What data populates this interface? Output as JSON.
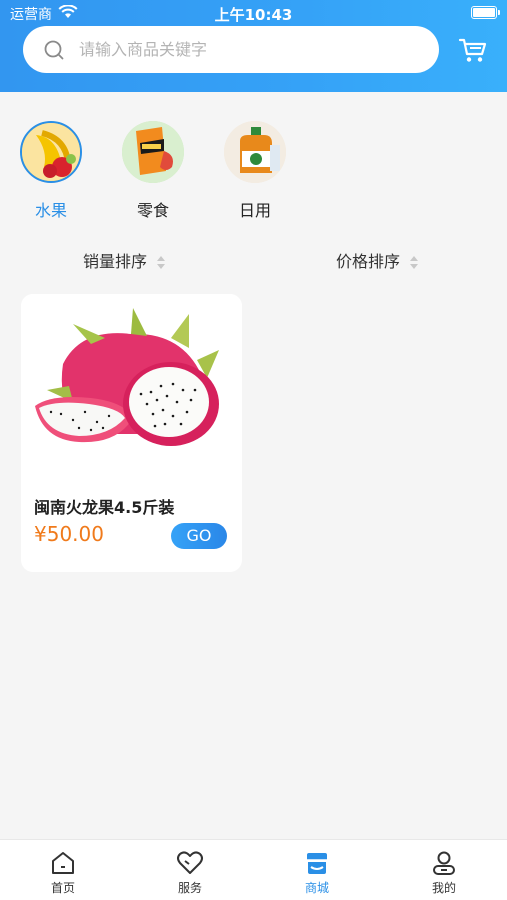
{
  "status_bar": {
    "carrier": "运营商",
    "time": "上午10:43"
  },
  "search": {
    "placeholder": "请输入商品关键字",
    "value": ""
  },
  "icons": {
    "search": "search-icon",
    "cart": "cart-icon",
    "wifi": "wifi-icon",
    "battery": "battery-icon"
  },
  "categories": [
    {
      "label": "水果",
      "icon": "fruit-image",
      "active": true
    },
    {
      "label": "零食",
      "icon": "snack-image",
      "active": false
    },
    {
      "label": "日用",
      "icon": "daily-goods-image",
      "active": false
    }
  ],
  "sort": {
    "sales": "销量排序",
    "price": "价格排序"
  },
  "products": [
    {
      "name": "闽南火龙果4.5斤装",
      "price": "¥50.00",
      "button": "GO",
      "image": "dragon-fruit-image"
    }
  ],
  "tabbar": [
    {
      "label": "首页",
      "icon": "home-icon",
      "active": false
    },
    {
      "label": "服务",
      "icon": "heart-icon",
      "active": false
    },
    {
      "label": "商城",
      "icon": "shop-icon",
      "active": true
    },
    {
      "label": "我的",
      "icon": "user-icon",
      "active": false
    }
  ],
  "colors": {
    "primary": "#2a8fe6",
    "price": "#f07a1b",
    "background": "#f5f5f5"
  }
}
